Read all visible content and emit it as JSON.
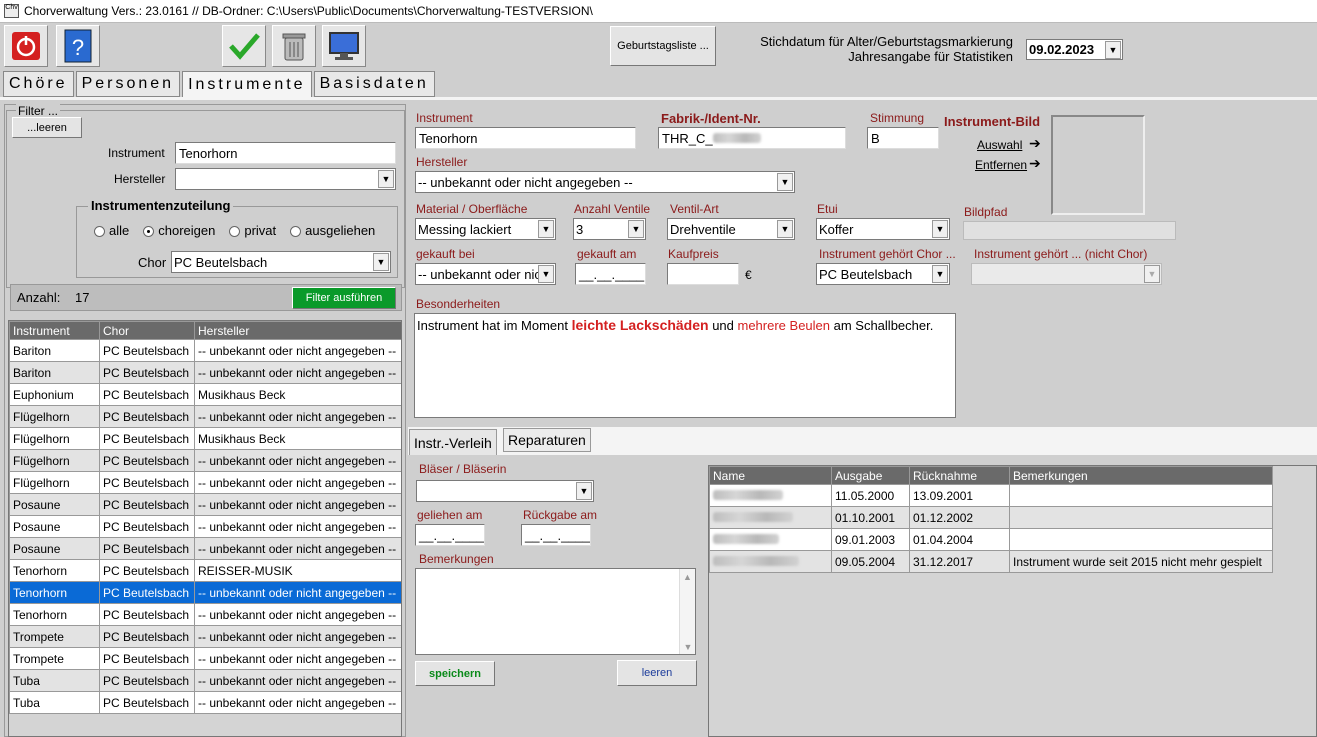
{
  "window": {
    "title": "Chorverwaltung Vers.: 23.0161 // DB-Ordner: C:\\Users\\Public\\Documents\\Chorverwaltung-TESTVERSION\\",
    "app_icon": "Chv"
  },
  "toolbar": {
    "exit_icon": "power-icon",
    "help_icon": "help-icon",
    "save_icon": "checkmark-icon",
    "delete_icon": "trash-icon",
    "monitor_icon": "monitor-icon",
    "birthday_list": "Geburtstagsliste ...",
    "stichdatum_label1": "Stichdatum für Alter/Geburtstagsmarkierung",
    "stichdatum_label2": "Jahresangabe für Statistiken",
    "date": "09.02.2023"
  },
  "tabs": [
    "Chöre",
    "Personen",
    "Instrumente",
    "Basisdaten"
  ],
  "filter": {
    "title": "Filter ...",
    "clear": "...leeren",
    "instrument_label": "Instrument",
    "instrument_value": "Tenorhorn",
    "hersteller_label": "Hersteller",
    "hersteller_value": "",
    "zuteilung_title": "Instrumentenzuteilung",
    "opt_alle": "alle",
    "opt_choreigen": "choreigen",
    "opt_privat": "privat",
    "opt_ausgeliehen": "ausgeliehen",
    "selected": "choreigen",
    "chor_label": "Chor",
    "chor_value": "PC Beutelsbach",
    "count_label": "Anzahl:",
    "count": "17",
    "run": "Filter ausführen"
  },
  "list": {
    "headers": [
      "Instrument",
      "Chor",
      "Hersteller"
    ],
    "rows": [
      [
        "Bariton",
        "PC Beutelsbach",
        "-- unbekannt oder nicht angegeben --"
      ],
      [
        "Bariton",
        "PC Beutelsbach",
        "-- unbekannt oder nicht angegeben --"
      ],
      [
        "Euphonium",
        "PC Beutelsbach",
        "Musikhaus Beck"
      ],
      [
        "Flügelhorn",
        "PC Beutelsbach",
        "-- unbekannt oder nicht angegeben --"
      ],
      [
        "Flügelhorn",
        "PC Beutelsbach",
        "Musikhaus Beck"
      ],
      [
        "Flügelhorn",
        "PC Beutelsbach",
        "-- unbekannt oder nicht angegeben --"
      ],
      [
        "Flügelhorn",
        "PC Beutelsbach",
        "-- unbekannt oder nicht angegeben --"
      ],
      [
        "Posaune",
        "PC Beutelsbach",
        "-- unbekannt oder nicht angegeben --"
      ],
      [
        "Posaune",
        "PC Beutelsbach",
        "-- unbekannt oder nicht angegeben --"
      ],
      [
        "Posaune",
        "PC Beutelsbach",
        "-- unbekannt oder nicht angegeben --"
      ],
      [
        "Tenorhorn",
        "PC Beutelsbach",
        "REISSER-MUSIK"
      ],
      [
        "Tenorhorn",
        "PC Beutelsbach",
        "-- unbekannt oder nicht angegeben --"
      ],
      [
        "Tenorhorn",
        "PC Beutelsbach",
        "-- unbekannt oder nicht angegeben --"
      ],
      [
        "Trompete",
        "PC Beutelsbach",
        "-- unbekannt oder nicht angegeben --"
      ],
      [
        "Trompete",
        "PC Beutelsbach",
        "-- unbekannt oder nicht angegeben --"
      ],
      [
        "Tuba",
        "PC Beutelsbach",
        "-- unbekannt oder nicht angegeben --"
      ],
      [
        "Tuba",
        "PC Beutelsbach",
        "-- unbekannt oder nicht angegeben --"
      ]
    ],
    "selected_index": 11
  },
  "detail": {
    "instrument_label": "Instrument",
    "instrument": "Tenorhorn",
    "fabrik_label": "Fabrik-/Ident-Nr.",
    "fabrik": "THR_C_",
    "stimmung_label": "Stimmung",
    "stimmung": "B",
    "bild_label": "Instrument-Bild",
    "auswahl": "Auswahl",
    "entfernen": "Entfernen",
    "hersteller_label": "Hersteller",
    "hersteller": "-- unbekannt oder nicht angegeben --",
    "material_label": "Material / Oberfläche",
    "material": "Messing lackiert",
    "ventile_label": "Anzahl Ventile",
    "ventile": "3",
    "ventilart_label": "Ventil-Art",
    "ventilart": "Drehventile",
    "etui_label": "Etui",
    "etui": "Koffer",
    "bildpfad_label": "Bildpfad",
    "bildpfad": "",
    "gekauft_bei_label": "gekauft bei",
    "gekauft_bei": "-- unbekannt oder nicht angegeben --",
    "gekauft_am_label": "gekauft am",
    "gekauft_am": "__.__.____",
    "kaufpreis_label": "Kaufpreis",
    "kaufpreis": "",
    "currency": "€",
    "gehoert_chor_label": "Instrument gehört Chor ...",
    "gehoert_chor": "PC Beutelsbach",
    "gehoert_nicht_label": "Instrument gehört ... (nicht Chor)",
    "gehoert_nicht": "",
    "besonderheiten_label": "Besonderheiten",
    "bes_1": "Instrument hat im Moment ",
    "bes_2": "leichte Lackschäden",
    "bes_3": " und ",
    "bes_4": "mehrere Beulen",
    "bes_5": " am Schallbecher."
  },
  "subtabs": [
    "Instr.-Verleih",
    "Reparaturen"
  ],
  "verleih": {
    "blaeser_label": "Bläser / Bläserin",
    "blaeser": "",
    "geliehen_label": "geliehen am",
    "geliehen": "__.__.____",
    "rueckgabe_label": "Rückgabe am",
    "rueckgabe": "__.__.____",
    "bem_label": "Bemerkungen",
    "save": "speichern",
    "clear": "leeren",
    "headers": [
      "Name",
      "Ausgabe",
      "Rücknahme",
      "Bemerkungen"
    ],
    "rows": [
      [
        "",
        "11.05.2000",
        "13.09.2001",
        ""
      ],
      [
        "",
        "01.10.2001",
        "01.12.2002",
        ""
      ],
      [
        "",
        "09.01.2003",
        "01.04.2004",
        ""
      ],
      [
        "",
        "09.05.2004",
        "31.12.2017",
        "Instrument wurde seit 2015 nicht mehr gespielt"
      ]
    ]
  },
  "colors": {
    "label_red": "#8b1a1a",
    "accent_green": "#0a9a2a",
    "selection": "#0a6ad6"
  }
}
